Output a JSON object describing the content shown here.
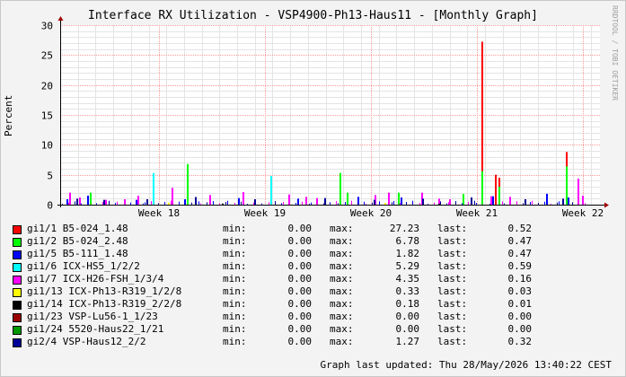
{
  "title": "Interface RX Utilization - VSP4900-Ph13-Haus11 - [Monthly Graph]",
  "watermark": "RRDTOOL / TOBI OETIKER",
  "labels": {
    "min": "min:",
    "max": "max:",
    "last": "last:"
  },
  "updated": "Graph last updated: Thu 28/May/2026 13:40:22 CEST",
  "chart_data": {
    "type": "bar",
    "ylabel": "Percent",
    "ylim": [
      0,
      30
    ],
    "yticks": [
      0,
      5,
      10,
      15,
      20,
      25,
      30
    ],
    "grid": true,
    "x_ticks": [
      "Week 18",
      "Week 19",
      "Week 20",
      "Week 21",
      "Week 22"
    ],
    "series": [
      {
        "name": "gi1/1 B5-024_1.48",
        "color": "#ff0000",
        "min": "0.00",
        "max": "27.23",
        "last": "0.52",
        "spikes": [
          [
            0.518,
            5.0
          ],
          [
            0.781,
            27.23
          ],
          [
            0.806,
            5.0
          ],
          [
            0.812,
            4.5
          ],
          [
            0.936,
            8.8
          ]
        ]
      },
      {
        "name": "gi1/2 B5-024_2.48",
        "color": "#00ff00",
        "min": "0.00",
        "max": "6.78",
        "last": "0.47",
        "spikes": [
          [
            0.055,
            2.0
          ],
          [
            0.234,
            6.78
          ],
          [
            0.518,
            5.3
          ],
          [
            0.531,
            2.0
          ],
          [
            0.625,
            2.0
          ],
          [
            0.745,
            1.8
          ],
          [
            0.781,
            5.6
          ],
          [
            0.812,
            3.0
          ],
          [
            0.936,
            6.4
          ]
        ]
      },
      {
        "name": "gi1/5 B5-111_1.48",
        "color": "#0000ff",
        "min": "0.00",
        "max": "1.82",
        "last": "0.47",
        "spikes": [
          [
            0.012,
            0.9
          ],
          [
            0.05,
            1.5
          ],
          [
            0.14,
            0.8
          ],
          [
            0.23,
            0.9
          ],
          [
            0.33,
            1.1
          ],
          [
            0.44,
            1.0
          ],
          [
            0.55,
            1.3
          ],
          [
            0.63,
            1.2
          ],
          [
            0.72,
            0.9
          ],
          [
            0.8,
            1.4
          ],
          [
            0.9,
            1.82
          ],
          [
            0.94,
            1.2
          ]
        ]
      },
      {
        "name": "gi1/6 ICX-HS5_1/2/2",
        "color": "#00ffff",
        "min": "0.00",
        "max": "5.29",
        "last": "0.59",
        "spikes": [
          [
            0.172,
            5.29
          ],
          [
            0.39,
            4.8
          ]
        ]
      },
      {
        "name": "gi1/7 ICX-H26-FSH_1/3/4",
        "color": "#ff00ff",
        "min": "0.00",
        "max": "4.35",
        "last": "0.16",
        "spikes": [
          [
            0.017,
            2.0
          ],
          [
            0.035,
            1.2
          ],
          [
            0.083,
            0.8
          ],
          [
            0.118,
            0.9
          ],
          [
            0.143,
            1.5
          ],
          [
            0.207,
            2.8
          ],
          [
            0.276,
            1.6
          ],
          [
            0.338,
            2.1
          ],
          [
            0.423,
            1.7
          ],
          [
            0.455,
            1.3
          ],
          [
            0.474,
            1.1
          ],
          [
            0.583,
            1.6
          ],
          [
            0.608,
            2.0
          ],
          [
            0.669,
            2.0
          ],
          [
            0.7,
            1.0
          ],
          [
            0.721,
            0.9
          ],
          [
            0.797,
            1.4
          ],
          [
            0.832,
            1.3
          ],
          [
            0.958,
            4.35
          ],
          [
            0.966,
            1.5
          ]
        ]
      },
      {
        "name": "gi1/13 ICX-Ph13-R319_1/2/8",
        "color": "#ffff00",
        "min": "0.00",
        "max": "0.33",
        "last": "0.03",
        "spikes": [
          [
            0.2,
            0.33
          ],
          [
            0.6,
            0.3
          ]
        ]
      },
      {
        "name": "gi1/14 ICX-Ph13-R319_2/2/8",
        "color": "#000000",
        "min": "0.00",
        "max": "0.18",
        "last": "0.01",
        "spikes": [
          [
            0.3,
            0.18
          ],
          [
            0.7,
            0.15
          ]
        ]
      },
      {
        "name": "gi1/23 VSP-Lu56-1_1/23",
        "color": "#990000",
        "min": "0.00",
        "max": "0.00",
        "last": "0.00",
        "spikes": []
      },
      {
        "name": "gi1/24 5520-Haus22_1/21",
        "color": "#009900",
        "min": "0.00",
        "max": "0.00",
        "last": "0.00",
        "spikes": []
      },
      {
        "name": "gi2/4 VSP-Haus12_2/2",
        "color": "#000099",
        "min": "0.00",
        "max": "1.27",
        "last": "0.32",
        "spikes": [
          [
            0.03,
            1.0
          ],
          [
            0.08,
            0.8
          ],
          [
            0.16,
            0.9
          ],
          [
            0.25,
            1.27
          ],
          [
            0.36,
            0.9
          ],
          [
            0.49,
            1.1
          ],
          [
            0.58,
            0.8
          ],
          [
            0.67,
            1.0
          ],
          [
            0.76,
            1.2
          ],
          [
            0.86,
            0.9
          ],
          [
            0.93,
            1.0
          ]
        ]
      }
    ]
  }
}
